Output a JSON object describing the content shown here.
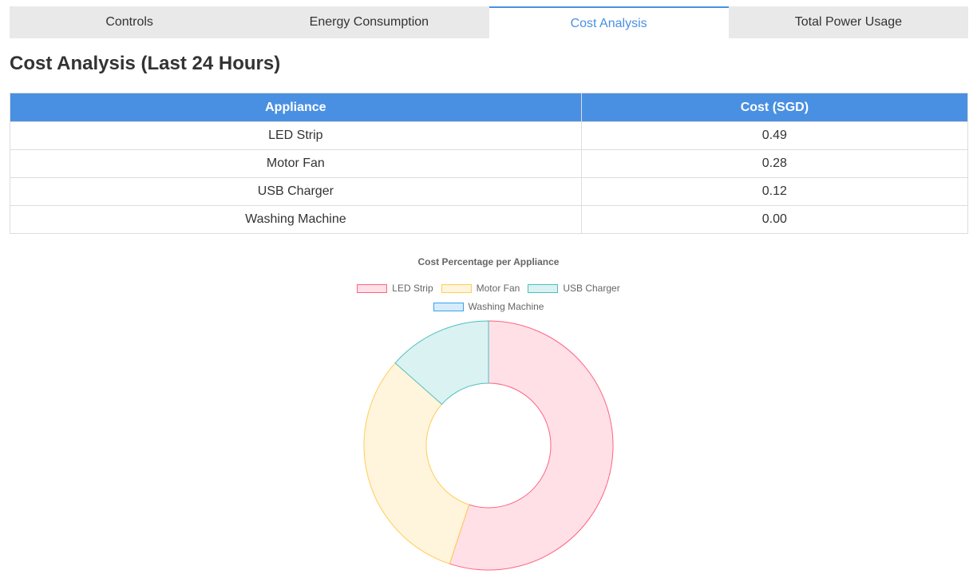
{
  "tabs": [
    {
      "label": "Controls"
    },
    {
      "label": "Energy Consumption"
    },
    {
      "label": "Cost Analysis"
    },
    {
      "label": "Total Power Usage"
    }
  ],
  "page_title": "Cost Analysis (Last 24 Hours)",
  "table": {
    "headers": [
      "Appliance",
      "Cost (SGD)"
    ],
    "rows": [
      {
        "appliance": "LED Strip",
        "cost": "0.49"
      },
      {
        "appliance": "Motor Fan",
        "cost": "0.28"
      },
      {
        "appliance": "USB Charger",
        "cost": "0.12"
      },
      {
        "appliance": "Washing Machine",
        "cost": "0.00"
      }
    ]
  },
  "colors": {
    "accent": "#4a90e2"
  },
  "chart_data": {
    "type": "pie",
    "title": "Cost Percentage per Appliance",
    "categories": [
      "LED Strip",
      "Motor Fan",
      "USB Charger",
      "Washing Machine"
    ],
    "values": [
      0.49,
      0.28,
      0.12,
      0.0
    ],
    "legend_position": "top",
    "donut": true,
    "colors": [
      {
        "fill": "#ffe0e6",
        "stroke": "#ff6384"
      },
      {
        "fill": "#fff4dc",
        "stroke": "#ffcd56"
      },
      {
        "fill": "#dbf2f2",
        "stroke": "#4bc0c0"
      },
      {
        "fill": "#d7ecfb",
        "stroke": "#36a2eb"
      }
    ]
  }
}
